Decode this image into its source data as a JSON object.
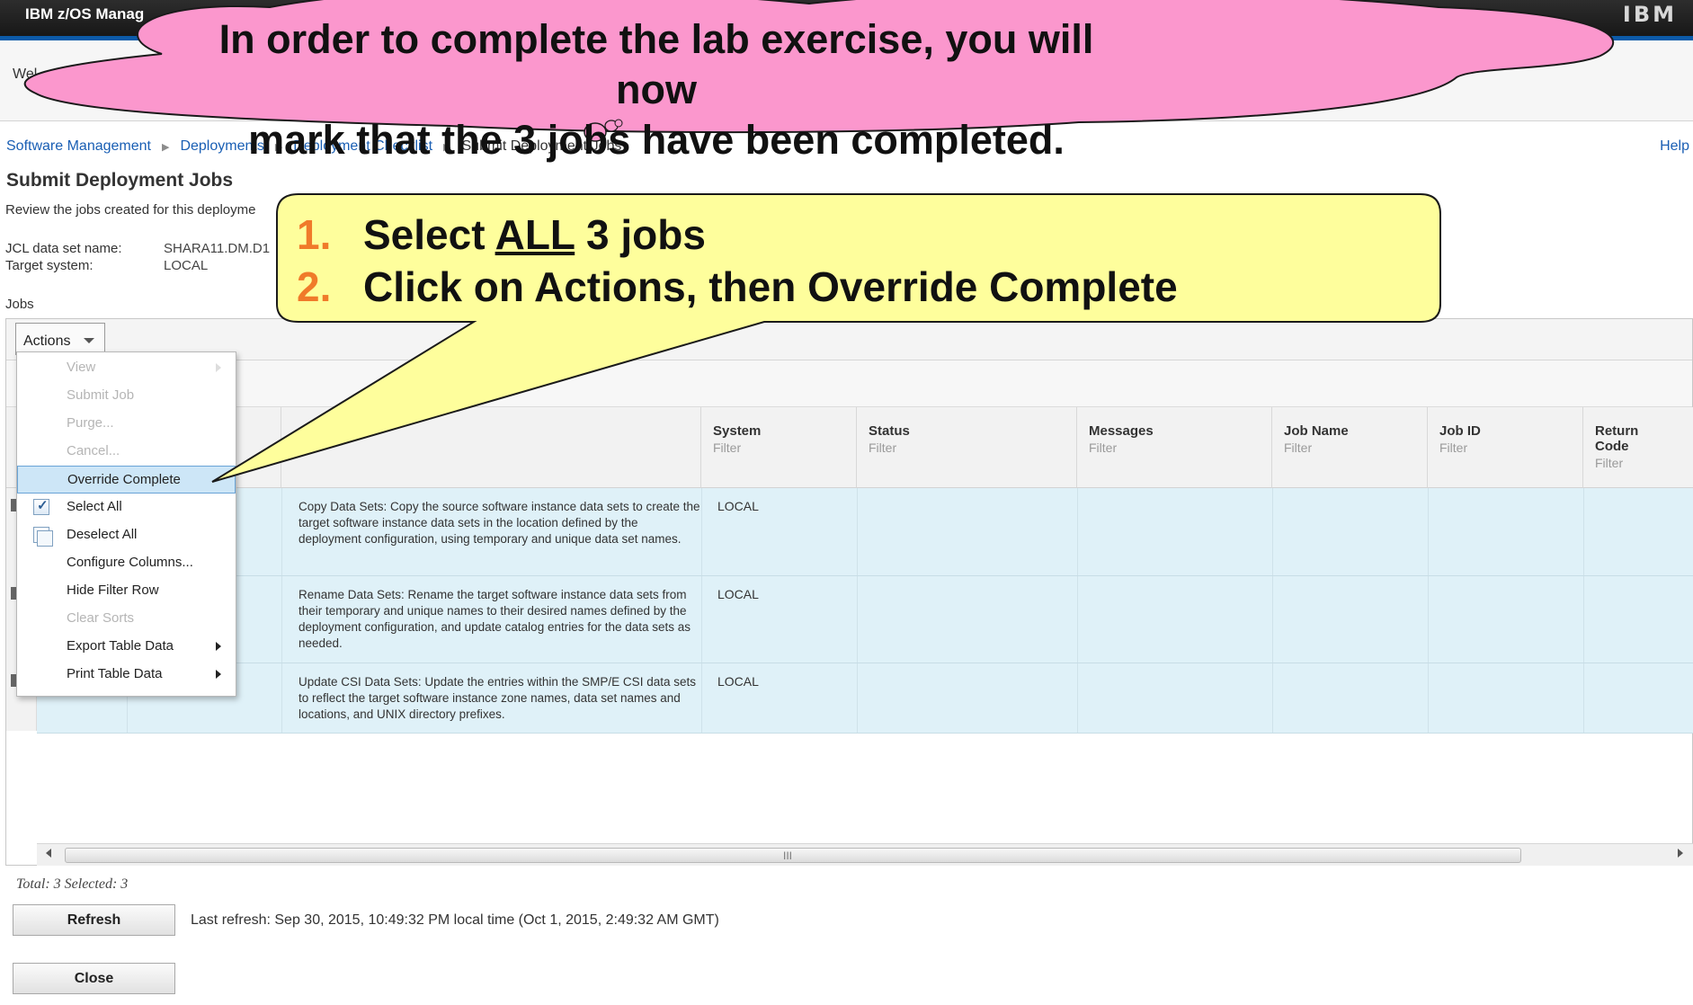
{
  "app": {
    "title": "IBM z/OS Manag",
    "welcome_text": "Wel"
  },
  "breadcrumb": {
    "items": [
      "Software Management",
      "Deployments",
      "Deployment Checklist",
      "Submit Deployment Jobs"
    ],
    "help": "Help"
  },
  "page": {
    "title": "Submit Deployment Jobs",
    "description": "Review the jobs created for this deployme",
    "jcl_label": "JCL data set name:",
    "jcl_value": "SHARA11.DM.D1",
    "target_label": "Target system:",
    "target_value": "LOCAL",
    "jobs_label": "Jobs"
  },
  "toolbar": {
    "actions_label": "Actions"
  },
  "table": {
    "columns": [
      {
        "label": "System",
        "filter": "Filter"
      },
      {
        "label": "Status",
        "filter": "Filter"
      },
      {
        "label": "Messages",
        "filter": "Filter"
      },
      {
        "label": "Job Name",
        "filter": "Filter"
      },
      {
        "label": "Job ID",
        "filter": "Filter"
      },
      {
        "label": "Return Code",
        "filter": "Filter"
      }
    ],
    "rows": [
      {
        "description": "Copy Data Sets: Copy the source software instance data sets to create the target software instance data sets in the location defined by the deployment configuration, using temporary and unique data set names.",
        "system": "LOCAL"
      },
      {
        "description": "Rename Data Sets: Rename the target software instance data sets from their temporary and unique names to their desired names defined by the deployment configuration, and update catalog entries for the data sets as needed.",
        "system": "LOCAL"
      },
      {
        "description": "Update CSI Data Sets: Update the entries within the SMP/E CSI data sets to reflect the target software instance zone names, data set names and locations, and UNIX directory prefixes.",
        "system": "LOCAL"
      }
    ],
    "scroll_grip": "III"
  },
  "actions_menu": {
    "items": [
      {
        "label": "View",
        "enabled": false
      },
      {
        "label": "Submit Job",
        "enabled": false
      },
      {
        "label": "Purge...",
        "enabled": false
      },
      {
        "label": "Cancel...",
        "enabled": false
      },
      {
        "label": "Override Complete",
        "enabled": true,
        "highlighted": true
      },
      {
        "label": "Select All",
        "enabled": true
      },
      {
        "label": "Deselect All",
        "enabled": true
      },
      {
        "label": "Configure Columns...",
        "enabled": true
      },
      {
        "label": "Hide Filter Row",
        "enabled": true
      },
      {
        "label": "Clear Sorts",
        "enabled": false
      },
      {
        "label": "Export Table Data",
        "enabled": true
      },
      {
        "label": "Print Table Data",
        "enabled": true
      }
    ]
  },
  "footer": {
    "totals": "Total: 3 Selected: 3",
    "refresh_label": "Refresh",
    "last_refresh": "Last refresh: Sep 30, 2015, 10:49:32 PM local time (Oct 1, 2015, 2:49:32 AM GMT)",
    "close_label": "Close"
  },
  "overlays": {
    "cloud_line1": "In order to complete the lab exercise, you will now",
    "cloud_line2": "mark that the 3 jobs have been completed.",
    "step1_num": "1.",
    "step1_pre": "Select ",
    "step1_underline": "ALL",
    "step1_post": " 3 jobs",
    "step2_num": "2.",
    "step2_text": "Click on Actions, then Override Complete"
  },
  "colors": {
    "cloud_fill": "#fb97cd",
    "callout_fill": "#fefe9c",
    "row_selected": "#dff1f8",
    "menu_highlight": "#cde6f7",
    "step_number": "#f07a2a"
  }
}
